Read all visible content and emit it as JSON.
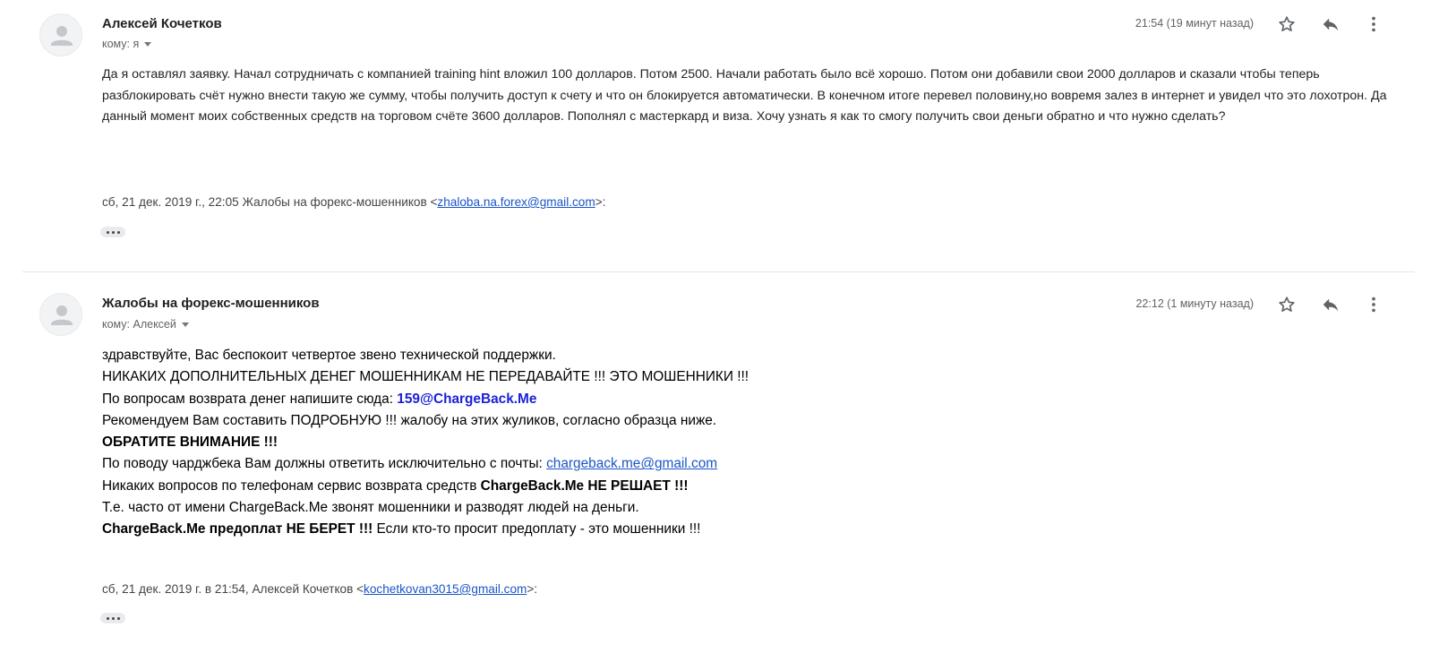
{
  "message1": {
    "sender": "Алексей Кочетков",
    "recipient": "кому: я",
    "time": "21:54 (19 минут назад)",
    "body": "Да я оставлял заявку. Начал сотрудничать с компанией training hint вложил 100 долларов. Потом 2500. Начали работать было всё хорошо. Потом они добавили свои 2000 долларов и сказали чтобы теперь разблокировать счёт нужно внести такую же сумму, чтобы получить доступ к счету и что он блокируется автоматически. В конечном итоге перевел половину,но вовремя залез в интернет и увидел что это лохотрон. Да данный момент моих собственных средств на торговом счёте 3600 долларов. Пополнял с мастеркард и виза. Хочу узнать я как то смогу получить свои деньги обратно и что нужно сделать?",
    "quote_header_prefix": "сб, 21 дек. 2019 г., 22:05 Жалобы на форекс-мошенников <",
    "quote_header_email": "zhaloba.na.forex@gmail.com",
    "quote_header_suffix": ">:"
  },
  "message2": {
    "sender": "Жалобы на форекс-мошенников",
    "recipient": "кому: Алексей",
    "time": "22:12 (1 минуту назад)",
    "lines": {
      "l1": "здравствуйте, Вас беспокоит четвертое звено технической поддержки.",
      "l2": "НИКАКИХ ДОПОЛНИТЕЛЬНЫХ ДЕНЕГ МОШЕННИКАМ НЕ ПЕРЕДАВАЙТЕ !!! ЭТО МОШЕННИКИ !!!",
      "l3_prefix": "По вопросам возврата денег напишите сюда: ",
      "l3_email": "159@ChargeBack.Me",
      "l4": "Рекомендуем Вам составить ПОДРОБНУЮ !!! жалобу на этих жуликов, согласно образца ниже.",
      "l5": "ОБРАТИТЕ ВНИМАНИЕ !!!",
      "l6_prefix": "По поводу чарджбека Вам должны ответить исключительно с почты: ",
      "l6_email": "chargeback.me@gmail.com",
      "l7_prefix": "Никаких вопросов по телефонам сервис возврата средств ",
      "l7_bold": "ChargeBack.Me НЕ РЕШАЕТ !!!",
      "l8": "Т.е. часто от имени ChargeBack.Me звонят мошенники и разводят людей на деньги.",
      "l9_bold": "ChargeBack.Me предоплат НЕ БЕРЕТ !!!",
      "l9_suffix": " Если кто-то просит предоплату - это мошенники !!!"
    },
    "quote_header_prefix": "сб, 21 дек. 2019 г. в 21:54, Алексей Кочетков <",
    "quote_header_email": "kochetkovan3015@gmail.com",
    "quote_header_suffix": ">:"
  },
  "icons": {
    "star": "star-icon",
    "reply": "reply-icon",
    "more": "more-vert-icon",
    "avatar": "person-icon"
  },
  "colors": {
    "link": "#1a55c7",
    "highlight_email": "#1a22d6"
  }
}
